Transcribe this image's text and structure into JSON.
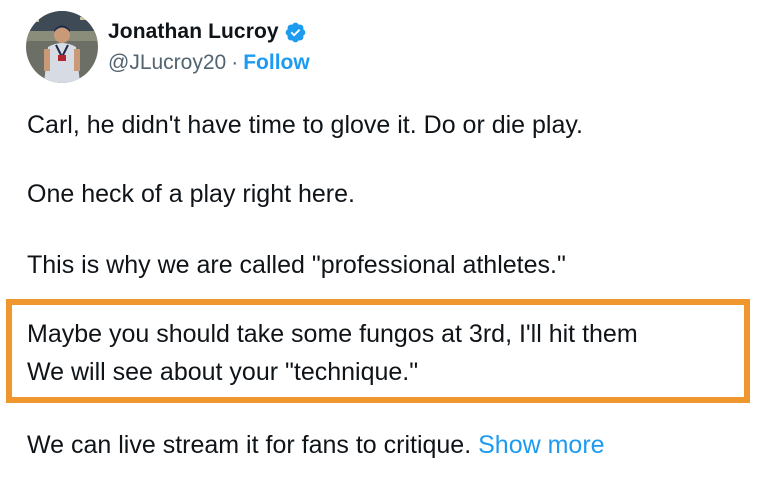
{
  "author": {
    "display_name": "Jonathan Lucroy",
    "handle": "@JLucroy20",
    "separator": "·",
    "follow_label": "Follow",
    "verified": true,
    "verified_color": "#1d9bf0"
  },
  "tweet": {
    "lines": [
      "Carl, he didn't have time to glove it. Do or die play.",
      "One heck of a play right here.",
      "This is why we are called \"professional athletes.\"",
      "Maybe you should take some fungos at 3rd, I'll hit them",
      "We will see about your \"technique.\"",
      "We can live stream it for fans to critique."
    ],
    "show_more_label": "Show more"
  },
  "highlight": {
    "color": "#f0962e"
  },
  "colors": {
    "text": "#0f1419",
    "secondary": "#536471",
    "accent": "#1d9bf0"
  }
}
